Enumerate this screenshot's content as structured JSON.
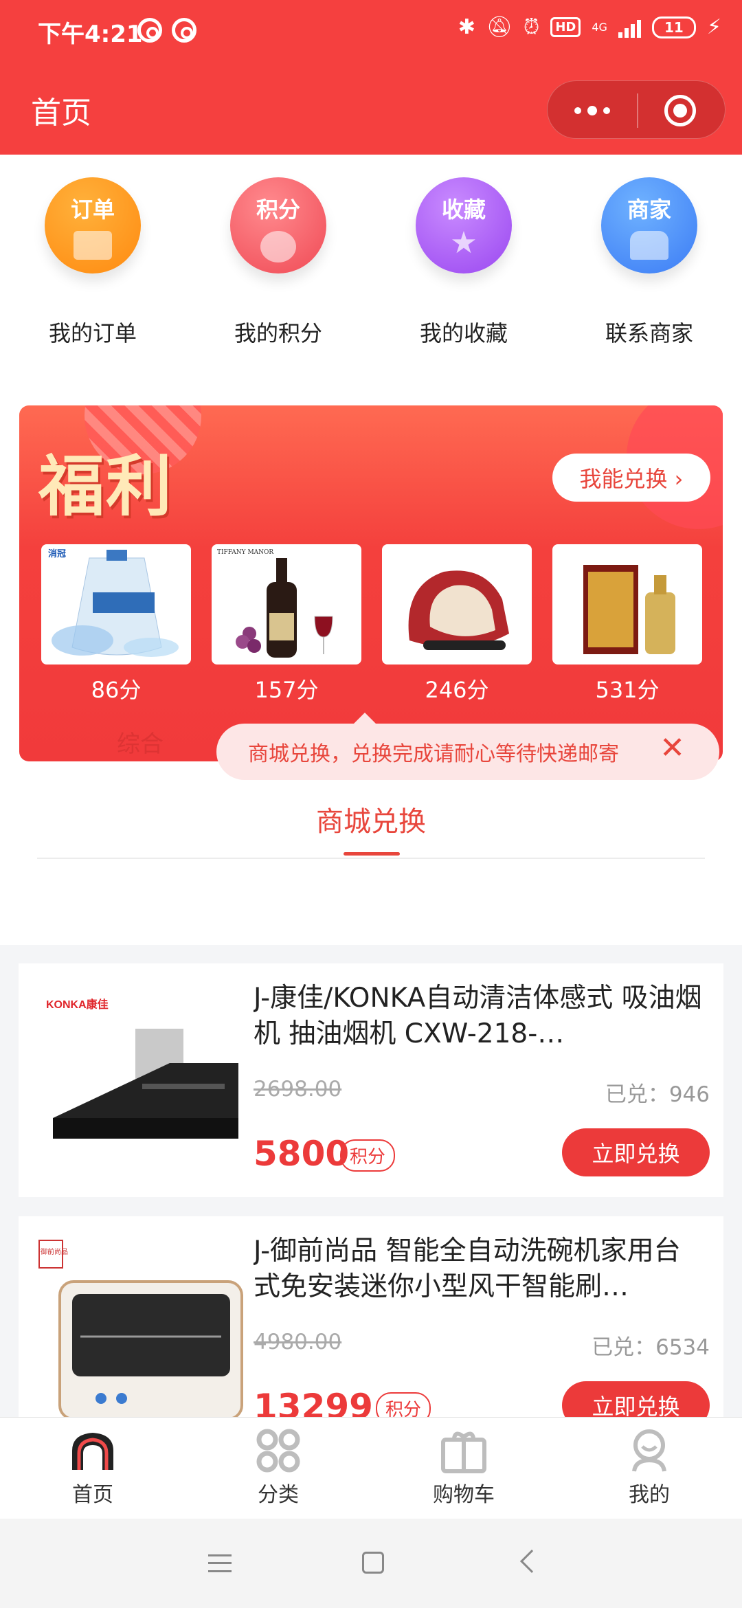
{
  "status_bar": {
    "time": "下午4:21",
    "hd": "HD",
    "network": "4G",
    "battery": "11"
  },
  "header": {
    "title": "首页",
    "more_icon": "more-dots-icon",
    "close_icon": "target-close-icon"
  },
  "quick_entries": [
    {
      "badge": "订单",
      "label": "我的订单",
      "color": "#ff9a1f",
      "icon": "receipt-icon"
    },
    {
      "badge": "积分",
      "label": "我的积分",
      "color": "#f5515c",
      "icon": "coins-icon"
    },
    {
      "badge": "收藏",
      "label": "我的收藏",
      "color": "#a95af5",
      "icon": "star-icon"
    },
    {
      "badge": "商家",
      "label": "联系商家",
      "color": "#4687f7",
      "icon": "store-icon"
    }
  ],
  "welfare": {
    "title": "福利",
    "redeem_button": "我能兑换 ›",
    "products": [
      {
        "score": "86分",
        "image": "detergent-bag"
      },
      {
        "score": "157分",
        "image": "wine-bottle"
      },
      {
        "score": "246分",
        "image": "massage-chair"
      },
      {
        "score": "531分",
        "image": "liquor-gift-box"
      }
    ]
  },
  "mall": {
    "title": "商城兑换",
    "sort_label": "综合",
    "tip": "商城兑换，兑换完成请耐心等待快递邮寄",
    "tip_close": "✕"
  },
  "goods": [
    {
      "name": "J-康佳/KONKA自动清洁体感式 吸油烟机 抽油烟机 CXW-218-…",
      "original_price": "2698.00",
      "sold": "已兑：946",
      "price": "5800",
      "points_tag": "积分",
      "button": "立即兑换",
      "brand": "KONKA康佳"
    },
    {
      "name": "J-御前尚品 智能全自动洗碗机家用台式免安装迷你小型风干智能刷…",
      "original_price": "4980.00",
      "sold": "已兑：6534",
      "price": "13299",
      "points_tag": "积分",
      "button": "立即兑换",
      "brand": "御前尚品"
    }
  ],
  "tabbar": [
    {
      "label": "首页",
      "icon": "home-icon",
      "active": true
    },
    {
      "label": "分类",
      "icon": "category-icon",
      "active": false
    },
    {
      "label": "购物车",
      "icon": "gift-cart-icon",
      "active": false
    },
    {
      "label": "我的",
      "icon": "user-icon",
      "active": false
    }
  ],
  "colors": {
    "brand_red": "#f5403f",
    "price_red": "#ec3a3a",
    "tip_bg": "#fde6e6"
  }
}
